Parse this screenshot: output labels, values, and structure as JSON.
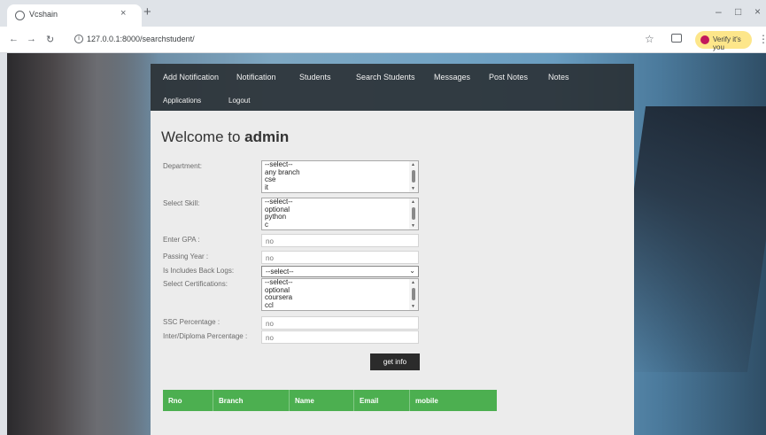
{
  "browser": {
    "tab_title": "Vcshain",
    "tab_close": "×",
    "new_tab": "+",
    "url": "127.0.0.1:8000/searchstudent/",
    "verify_label": "Verify it's you",
    "win_min": "–",
    "win_max": "□",
    "win_close": "×",
    "back": "←",
    "forward": "→",
    "reload": "↻",
    "star": "☆",
    "menu": "⋮"
  },
  "nav": {
    "row1": [
      "Add Notification",
      "Notification",
      "Students",
      "Search Students",
      "Messages",
      "Post Notes",
      "Notes"
    ],
    "row2": [
      "Applications",
      "Logout"
    ]
  },
  "welcome": {
    "prefix": "Welcome to ",
    "user": "admin"
  },
  "form": {
    "department_label": "Department:",
    "department_options": [
      "--select--",
      "any branch",
      "cse",
      "it"
    ],
    "skill_label": "Select Skill:",
    "skill_options": [
      "--select--",
      "optional",
      "python",
      "c"
    ],
    "cgpa_label": "Enter GPA :",
    "cgpa_value": "no",
    "passing_label": "Passing Year :",
    "passing_value": "no",
    "backlogs_label": "Is Includes Back Logs:",
    "backlogs_value": "--select--",
    "cert_label": "Select Certifications:",
    "cert_options": [
      "--select--",
      "optional",
      "coursera",
      "ccl"
    ],
    "ssc_label": "SSC Percentage :",
    "ssc_value": "no",
    "inter_label": "Inter/Diploma Percentage :",
    "inter_value": "no",
    "submit_label": "get info"
  },
  "results_table": {
    "columns": [
      "Rno",
      "Branch",
      "Name",
      "Email",
      "mobile"
    ]
  },
  "colors": {
    "table_header": "#4caf50",
    "navbar": "#2c3035",
    "button": "#2b2b2b"
  }
}
